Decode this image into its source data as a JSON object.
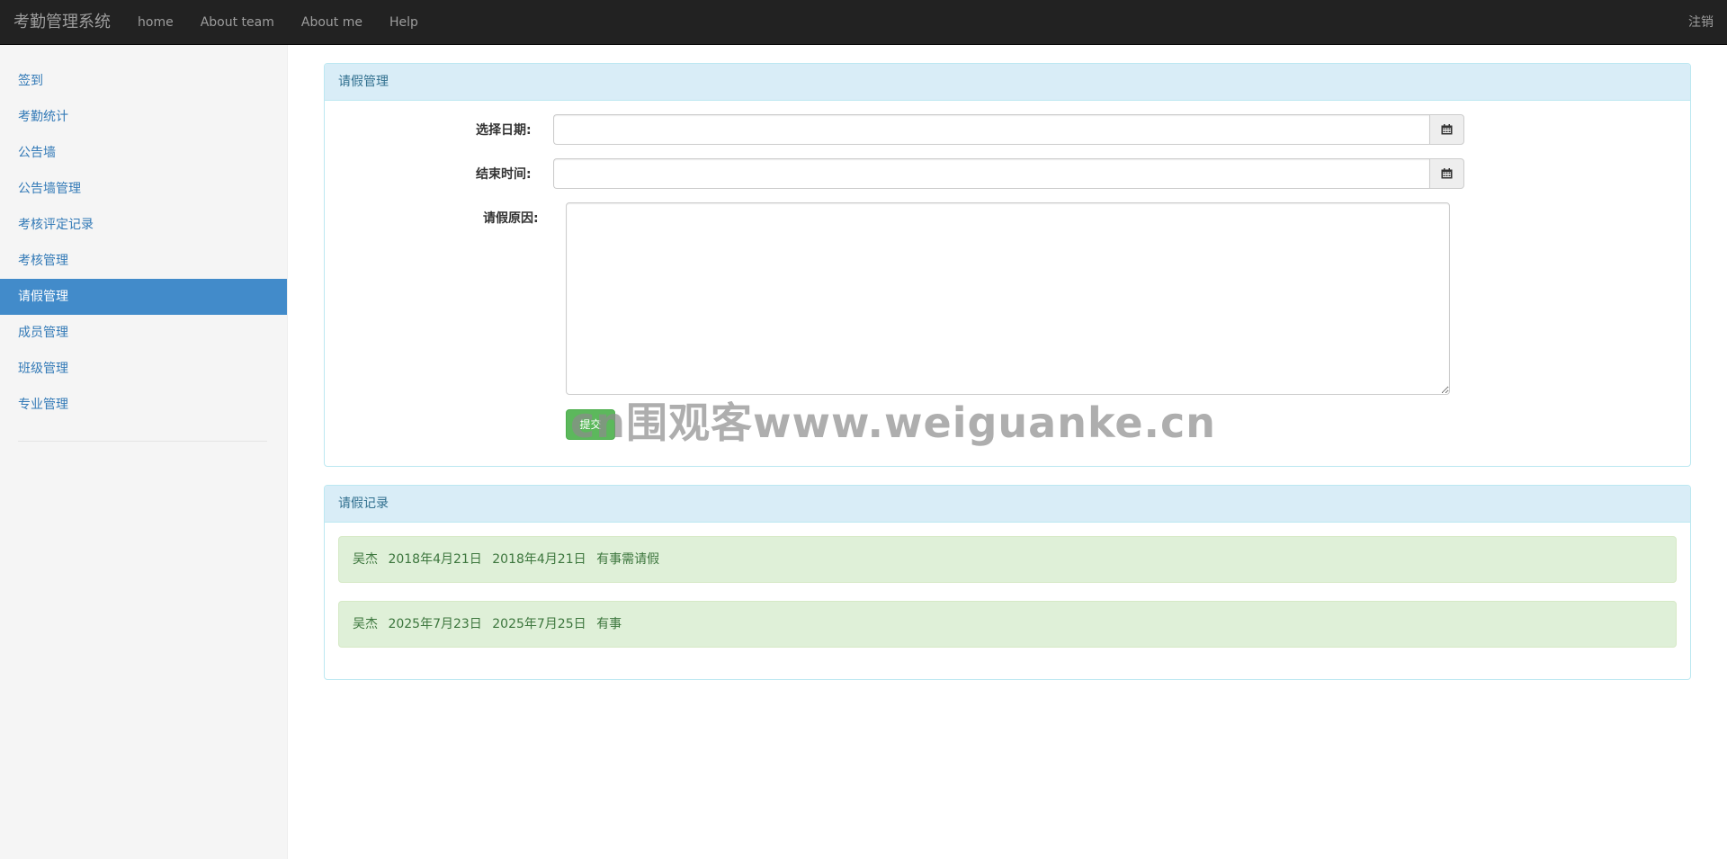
{
  "navbar": {
    "brand": "考勤管理系统",
    "links": [
      "home",
      "About team",
      "About me",
      "Help"
    ],
    "logout": "注销"
  },
  "sidebar": {
    "items": [
      "签到",
      "考勤统计",
      "公告墙",
      "公告墙管理",
      "考核评定记录",
      "考核管理",
      "请假管理",
      "成员管理",
      "班级管理",
      "专业管理"
    ],
    "active": "请假管理"
  },
  "leave_panel": {
    "title": "请假管理",
    "start_label": "选择日期:",
    "end_label": "结束时间:",
    "reason_label": "请假原因:",
    "start_value": "",
    "end_value": "",
    "reason_value": "",
    "submit_label": "提交"
  },
  "records_panel": {
    "title": "请假记录",
    "records": [
      {
        "name": "吴杰",
        "start": "2018年4月21日",
        "end": "2018年4月21日",
        "reason": "有事需请假"
      },
      {
        "name": "吴杰",
        "start": "2025年7月23日",
        "end": "2025年7月25日",
        "reason": "有事"
      }
    ]
  },
  "watermark": "cn围观客www.weiguanke.cn",
  "icons": {
    "date_picker": "calendar-icon"
  },
  "colors": {
    "navbar": "#222222",
    "sidebar_active": "#428bca",
    "panel_heading": "#d9edf7",
    "record_bg": "#dff0d8",
    "submit": "#5cb85c"
  }
}
